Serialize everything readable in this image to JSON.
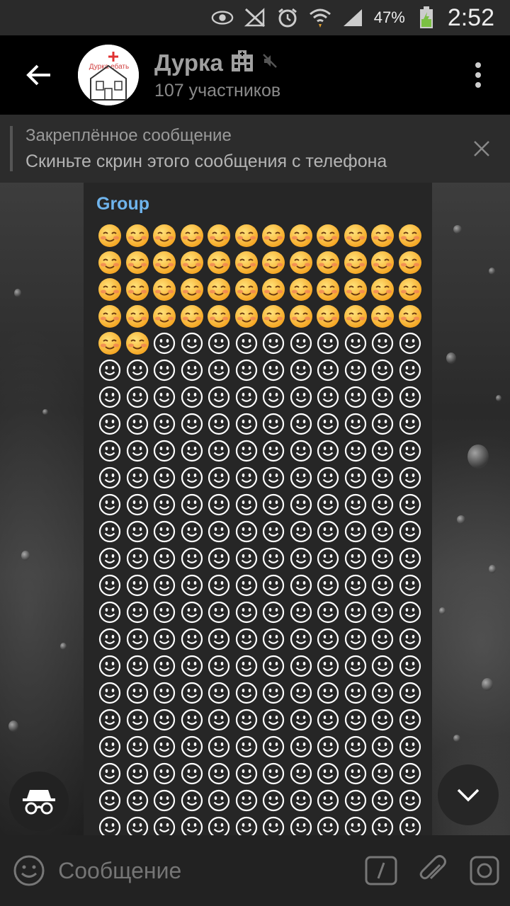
{
  "status_bar": {
    "icons": [
      "eye-icon",
      "no-signal-icon",
      "alarm-icon",
      "wifi-icon",
      "signal-icon",
      "battery-icon"
    ],
    "battery": "47%",
    "time": "2:52"
  },
  "header": {
    "title": "Дурка",
    "title_icon": "hospital-icon",
    "muted_icon": "mute-icon",
    "subtitle": "107 участников",
    "avatar_text": "Дурка ебать"
  },
  "pinned": {
    "title": "Закреплённое сообщение",
    "body": "Скиньте скрин этого сообщения с телефона"
  },
  "message": {
    "sender": "Group",
    "emoji_rows": 23,
    "emoji_columns": 12,
    "blushing_count": 50,
    "blushing_glyph": "☺️",
    "outline_glyph": "☺"
  },
  "input": {
    "placeholder": "Сообщение"
  },
  "colors": {
    "accent": "#6fb4ec",
    "bubble": "#262626",
    "header": "#000000"
  }
}
